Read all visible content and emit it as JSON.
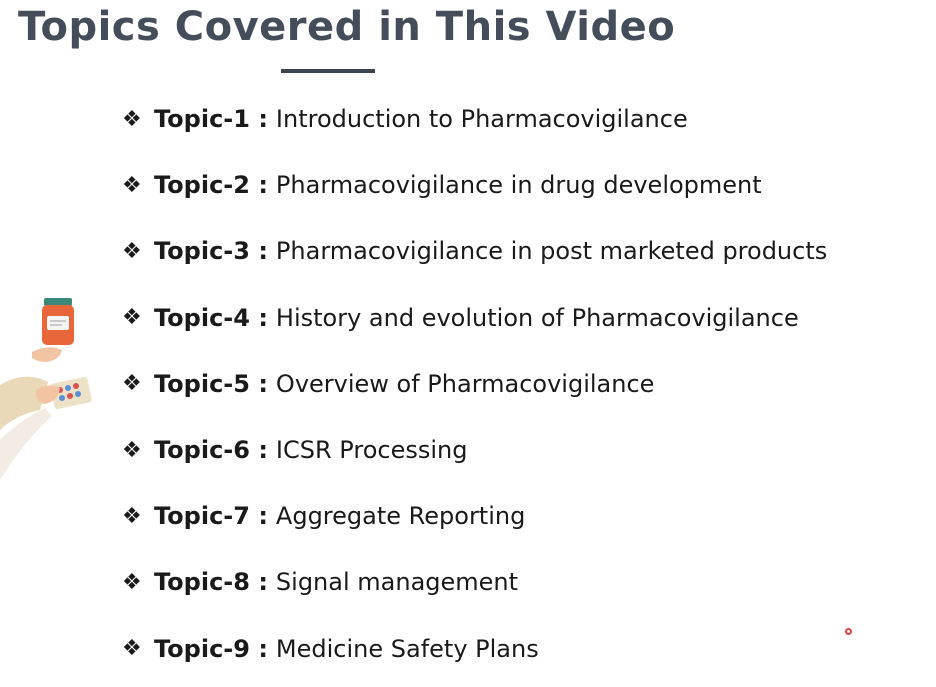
{
  "slide": {
    "title": "Topics Covered in This Video"
  },
  "bullet_icon": "four-diamond-bullet-icon",
  "topics": [
    {
      "label": "Topic-1 :",
      "text": "Introduction to Pharmacovigilance"
    },
    {
      "label": "Topic-2 :",
      "text": "Pharmacovigilance in drug development"
    },
    {
      "label": "Topic-3 :",
      "text": "Pharmacovigilance in post marketed products"
    },
    {
      "label": "Topic-4 :",
      "text": "History and evolution of Pharmacovigilance"
    },
    {
      "label": "Topic-5 :",
      "text": "Overview of Pharmacovigilance"
    },
    {
      "label": "Topic-6 :",
      "text": "ICSR Processing"
    },
    {
      "label": "Topic-7 :",
      "text": "Aggregate Reporting"
    },
    {
      "label": "Topic-8 :",
      "text": "Signal management"
    },
    {
      "label": "Topic-9 :",
      "text": "Medicine Safety Plans"
    }
  ],
  "colors": {
    "title": "#454d5b",
    "underline": "#3d4452",
    "text": "#1a1a1a",
    "pointer": "#e0443a",
    "bottle": "#e8663a"
  }
}
